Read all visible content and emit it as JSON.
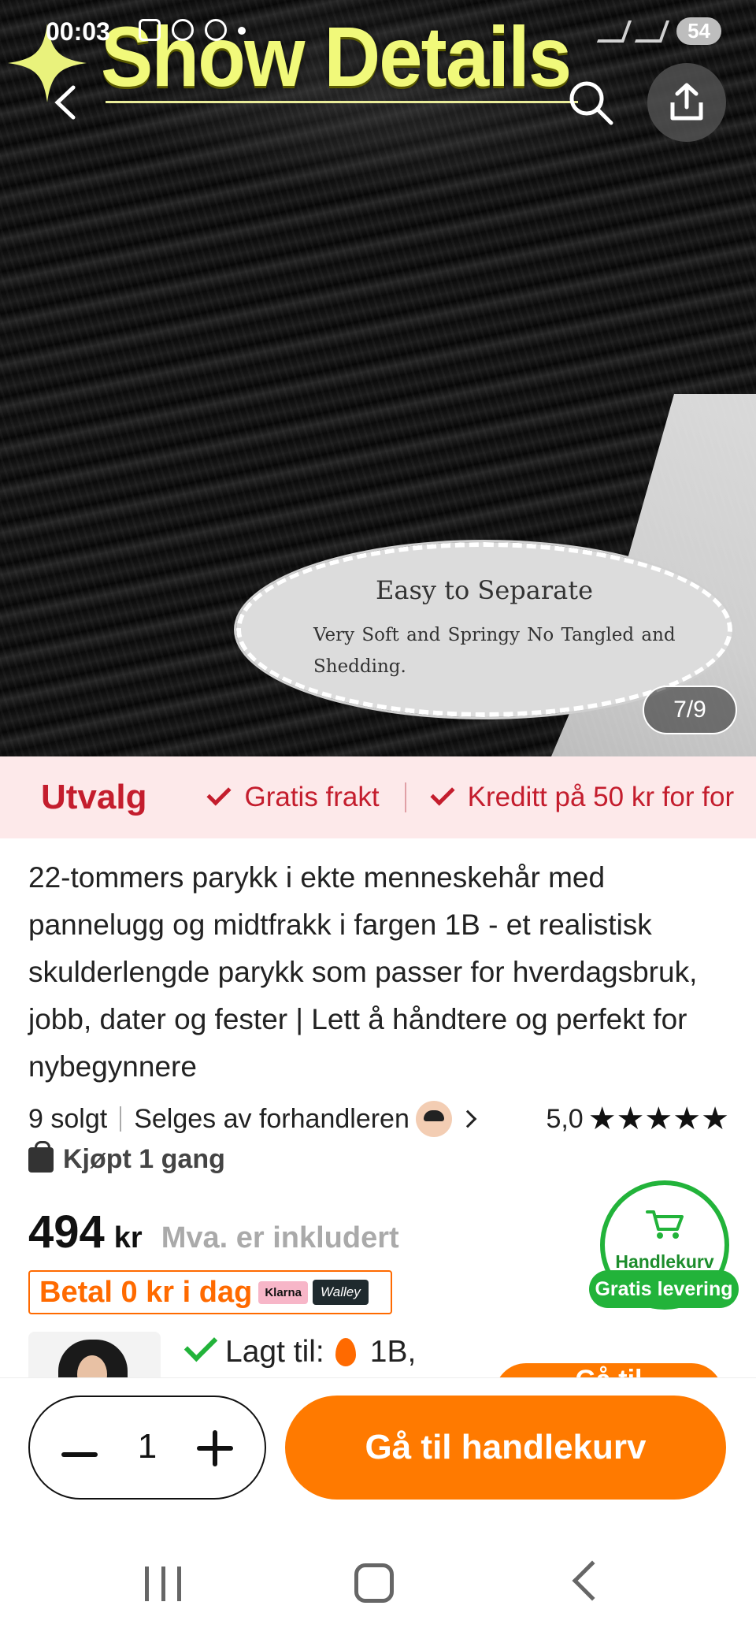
{
  "status_bar": {
    "time": "00:03",
    "battery": "54"
  },
  "hero": {
    "banner_title": "Show Details",
    "callout_title": "Easy to Separate",
    "callout_text": "Very Soft and Springy    No Tangled and Shedding.",
    "pager": "7/9"
  },
  "perks": {
    "title": "Utvalg",
    "items": [
      "Gratis frakt",
      "Kreditt på 50 kr for for"
    ]
  },
  "product": {
    "title": "22-tommers parykk i ekte menneskehår med pannelugg og midtfrakk i fargen 1B - et realistisk skulderlengde parykk som passer for hverdagsbruk, jobb, dater og fester | Lett å håndtere og perfekt for nybegynnere",
    "sold": "9 solgt",
    "seller": "Selges av forhandleren",
    "rating": "5,0",
    "stars": 5,
    "bought": "Kjøpt 1 gang",
    "price": "494",
    "currency": "kr",
    "vat": "Mva. er inkludert",
    "pay_later": "Betal 0 kr i dag",
    "klarna": "Klarna",
    "walley": "Walley"
  },
  "cart_badge": {
    "label": "Handlekurv",
    "free_shipping": "Gratis levering"
  },
  "added": {
    "label": "Lagt til:",
    "variant": "1B,",
    "peek_button": "Gå til"
  },
  "bottom_bar": {
    "quantity": "1",
    "cart_button": "Gå til handlekurv"
  },
  "colors": {
    "accent_orange": "#ff7a00",
    "perk_red": "#c41d2d",
    "green": "#22b33a",
    "perk_bg": "#fde9ea"
  },
  "icons": [
    "back-icon",
    "search-icon",
    "share-icon",
    "check-icon",
    "bag-icon",
    "cart-icon",
    "flame-icon",
    "minus-icon",
    "plus-icon"
  ]
}
